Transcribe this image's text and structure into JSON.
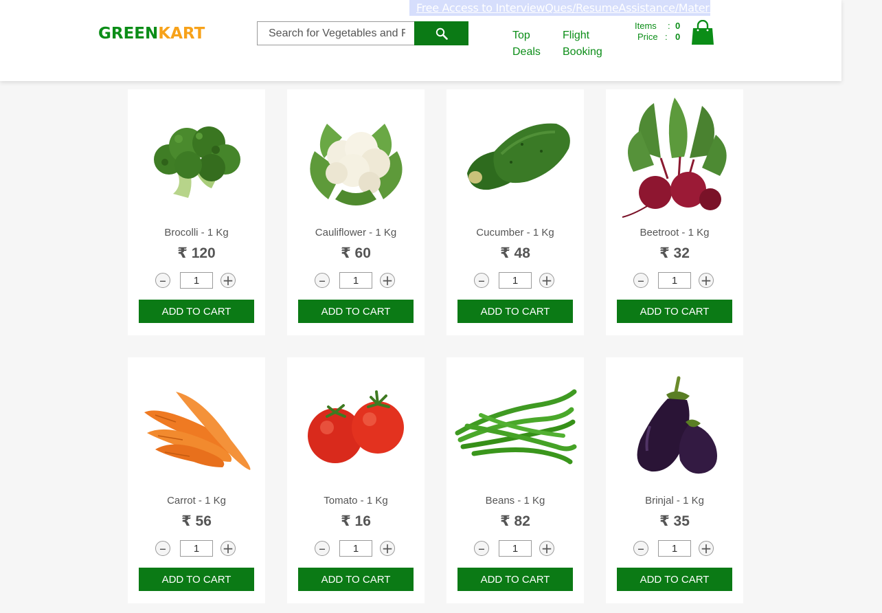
{
  "brand": {
    "part1": "GREEN",
    "part2": "KART"
  },
  "search": {
    "placeholder": "Search for Vegetables and Fruits"
  },
  "promo": {
    "text": "Free Access to InterviewQues/ResumeAssistance/Material"
  },
  "nav": [
    {
      "line1": "Top",
      "line2": "Deals"
    },
    {
      "line1": "Flight",
      "line2": "Booking"
    }
  ],
  "cart": {
    "items_label": "Items",
    "items_value": "0",
    "price_label": "Price",
    "price_value": "0",
    "separator": ":"
  },
  "colors": {
    "brand_green": "#0b8d17",
    "brand_orange": "#f7a21a",
    "button_green": "#0b7a15"
  },
  "products": [
    {
      "name": "Brocolli - 1 Kg",
      "price": "₹ 120",
      "qty": "1",
      "button": "ADD TO CART",
      "icon": "broccoli-icon"
    },
    {
      "name": "Cauliflower - 1 Kg",
      "price": "₹ 60",
      "qty": "1",
      "button": "ADD TO CART",
      "icon": "cauliflower-icon"
    },
    {
      "name": "Cucumber - 1 Kg",
      "price": "₹ 48",
      "qty": "1",
      "button": "ADD TO CART",
      "icon": "cucumber-icon"
    },
    {
      "name": "Beetroot - 1 Kg",
      "price": "₹ 32",
      "qty": "1",
      "button": "ADD TO CART",
      "icon": "beetroot-icon"
    },
    {
      "name": "Carrot - 1 Kg",
      "price": "₹ 56",
      "qty": "1",
      "button": "ADD TO CART",
      "icon": "carrot-icon"
    },
    {
      "name": "Tomato - 1 Kg",
      "price": "₹ 16",
      "qty": "1",
      "button": "ADD TO CART",
      "icon": "tomato-icon"
    },
    {
      "name": "Beans - 1 Kg",
      "price": "₹ 82",
      "qty": "1",
      "button": "ADD TO CART",
      "icon": "beans-icon"
    },
    {
      "name": "Brinjal - 1 Kg",
      "price": "₹ 35",
      "qty": "1",
      "button": "ADD TO CART",
      "icon": "brinjal-icon"
    }
  ],
  "stepper": {
    "minus": "–",
    "plus": "+"
  }
}
